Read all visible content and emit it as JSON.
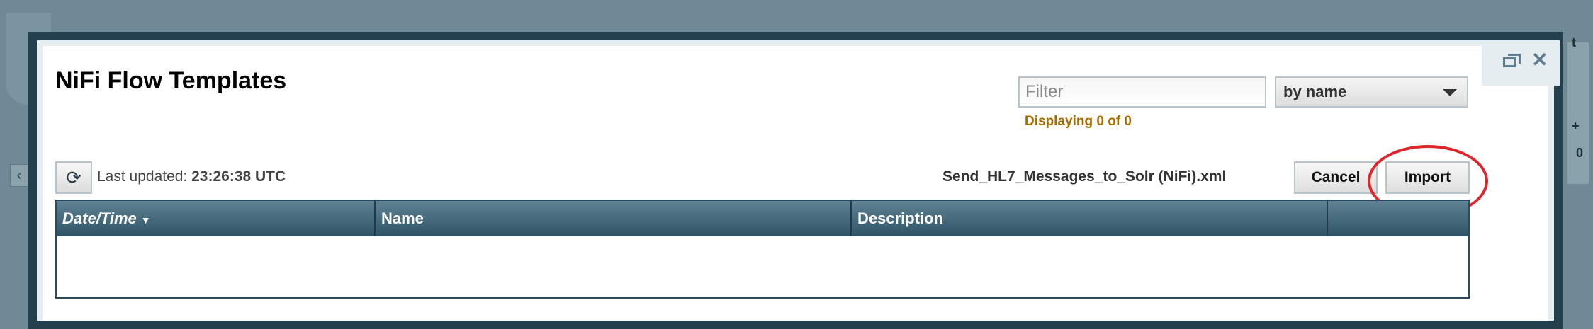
{
  "dialog": {
    "title": "NiFi Flow Templates",
    "filter": {
      "placeholder": "Filter",
      "value": ""
    },
    "filter_type": {
      "selected": "by name"
    },
    "displaying": "Displaying 0 of 0",
    "last_updated_label": "Last updated:",
    "last_updated_time": "23:26:38 UTC",
    "selected_file": "Send_HL7_Messages_to_Solr (NiFi).xml",
    "buttons": {
      "cancel": "Cancel",
      "import": "Import"
    },
    "table": {
      "columns": [
        "Date/Time",
        "Name",
        "Description",
        ""
      ],
      "rows": []
    }
  },
  "background": {
    "right_badges": [
      "t",
      "+",
      "0"
    ]
  },
  "colors": {
    "header_bg": "#2f5467",
    "annotation_circle": "#e0262b",
    "displaying_text": "#a86b00"
  }
}
